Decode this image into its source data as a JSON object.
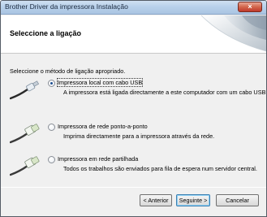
{
  "window": {
    "title": "Brother Driver da impressora Instalação",
    "close_label": "×"
  },
  "header": {
    "title": "Seleccione a ligação"
  },
  "main": {
    "instruction": "Seleccione o método de ligação apropriado.",
    "options": [
      {
        "label": "Impressora local com cabo USB",
        "description": "A impressora está ligada directamente a este computador com um cabo USB.",
        "selected": true,
        "icon": "usb-cable-icon"
      },
      {
        "label": "Impressora de rede ponto-a-ponto",
        "description": "Imprima directamente para a impressora através da rede.",
        "selected": false,
        "icon": "network-cable-icon"
      },
      {
        "label": "Impressora em rede partilhada",
        "description": "Todos os trabalhos são enviados para fila de espera num servidor central.",
        "selected": false,
        "icon": "network-cable-icon"
      }
    ]
  },
  "footer": {
    "back_label": "< Anterior",
    "next_label": "Seguinte >",
    "cancel_label": "Cancelar"
  }
}
